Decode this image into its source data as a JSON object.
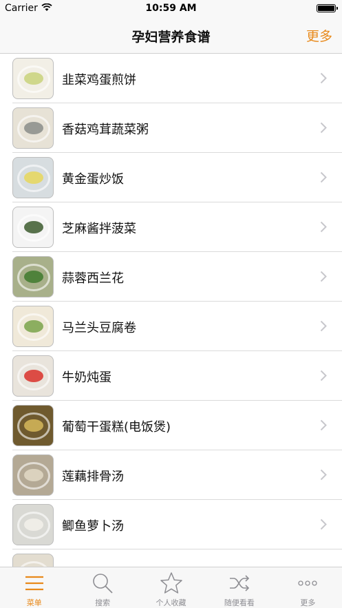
{
  "status_bar": {
    "carrier": "Carrier",
    "time": "10:59 AM"
  },
  "nav": {
    "title": "孕妇营养食谱",
    "more_label": "更多"
  },
  "recipes": [
    {
      "name": "韭菜鸡蛋煎饼",
      "colors": [
        "#f2efe6",
        "#c9d27a"
      ]
    },
    {
      "name": "香菇鸡茸蔬菜粥",
      "colors": [
        "#e7e2d6",
        "#8a8d8a"
      ]
    },
    {
      "name": "黄金蛋炒饭",
      "colors": [
        "#d7dde0",
        "#e8d75a"
      ]
    },
    {
      "name": "芝麻酱拌菠菜",
      "colors": [
        "#f4f4f4",
        "#3c5a2e"
      ]
    },
    {
      "name": "蒜蓉西兰花",
      "colors": [
        "#a8b08a",
        "#3f7a2d"
      ]
    },
    {
      "name": "马兰头豆腐卷",
      "colors": [
        "#f0e9d9",
        "#7aa34a"
      ]
    },
    {
      "name": "牛奶炖蛋",
      "colors": [
        "#e9e4dc",
        "#d9312a"
      ]
    },
    {
      "name": "葡萄干蛋糕(电饭煲)",
      "colors": [
        "#6f5a2e",
        "#d6b95a"
      ]
    },
    {
      "name": "莲藕排骨汤",
      "colors": [
        "#b4a995",
        "#e2d9c5"
      ]
    },
    {
      "name": "鲫鱼萝卜汤",
      "colors": [
        "#d9d9d4",
        "#f2f0ea"
      ]
    },
    {
      "name": "",
      "colors": [
        "#e3ddd0",
        "#bfae92"
      ]
    }
  ],
  "tabs": [
    {
      "label": "菜单",
      "icon": "menu-icon",
      "active": true
    },
    {
      "label": "搜索",
      "icon": "search-icon",
      "active": false
    },
    {
      "label": "个人收藏",
      "icon": "star-icon",
      "active": false
    },
    {
      "label": "随便看看",
      "icon": "shuffle-icon",
      "active": false
    },
    {
      "label": "更多",
      "icon": "more-icon",
      "active": false
    }
  ],
  "colors": {
    "accent": "#e8891a",
    "inactive": "#8e8e93"
  }
}
